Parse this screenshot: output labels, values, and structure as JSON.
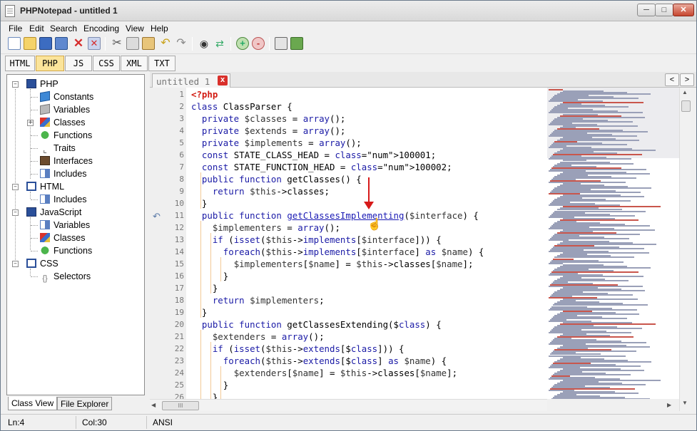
{
  "window": {
    "title": "PHPNotepad - untitled 1"
  },
  "menu": [
    "File",
    "Edit",
    "Search",
    "Encoding",
    "View",
    "Help"
  ],
  "toolbar": {
    "icons": [
      "new-file-icon",
      "open-file-icon",
      "save-icon",
      "save-all-icon",
      "close-file-icon",
      "close-all-icon",
      "cut-icon",
      "copy-icon",
      "paste-icon",
      "undo-icon",
      "redo-icon",
      "find-icon",
      "replace-icon",
      "zoom-in-icon",
      "zoom-out-icon",
      "print-icon",
      "exit-icon"
    ]
  },
  "languages": [
    "HTML",
    "PHP",
    "JS",
    "CSS",
    "XML",
    "TXT"
  ],
  "active_language": "PHP",
  "tree": {
    "php": {
      "label": "PHP",
      "children": [
        "Constants",
        "Variables",
        "Classes",
        "Functions",
        "Traits",
        "Interfaces",
        "Includes"
      ]
    },
    "html": {
      "label": "HTML",
      "children": [
        "Includes"
      ]
    },
    "javascript": {
      "label": "JavaScript",
      "children": [
        "Variables",
        "Classes",
        "Functions"
      ]
    },
    "css": {
      "label": "CSS",
      "children": [
        "Selectors"
      ]
    }
  },
  "side_tabs": [
    "Class View",
    "File Explorer"
  ],
  "editor": {
    "tab_label": "untitled 1",
    "tab_close": "x",
    "nav_left": "<",
    "nav_right": ">"
  },
  "code_lines": [
    "<?php",
    "class ClassParser {",
    "  private $classes = array();",
    "  private $extends = array();",
    "  private $implements = array();",
    "  const STATE_CLASS_HEAD = 100001;",
    "  const STATE_FUNCTION_HEAD = 100002;",
    "  public function getClasses() {",
    "    return $this->classes;",
    "  }",
    "  public function getClassesImplementing($interface) {",
    "    $implementers = array();",
    "    if (isset($this->implements[$interface])) {",
    "      foreach($this->implements[$interface] as $name) {",
    "        $implementers[$name] = $this->classes[$name];",
    "      }",
    "    }",
    "    return $implementers;",
    "  }",
    "  public function getClassesExtending($class) {",
    "    $extenders = array();",
    "    if (isset($this->extends[$class])) {",
    "      foreach($this->extends[$class] as $name) {",
    "        $extenders[$name] = $this->classes[$name];",
    "      }",
    "    }"
  ],
  "status": {
    "line": "Ln:4",
    "col": "Col:30",
    "encoding": "ANSI"
  },
  "scroll": {
    "hscroll_thumb": "III"
  }
}
